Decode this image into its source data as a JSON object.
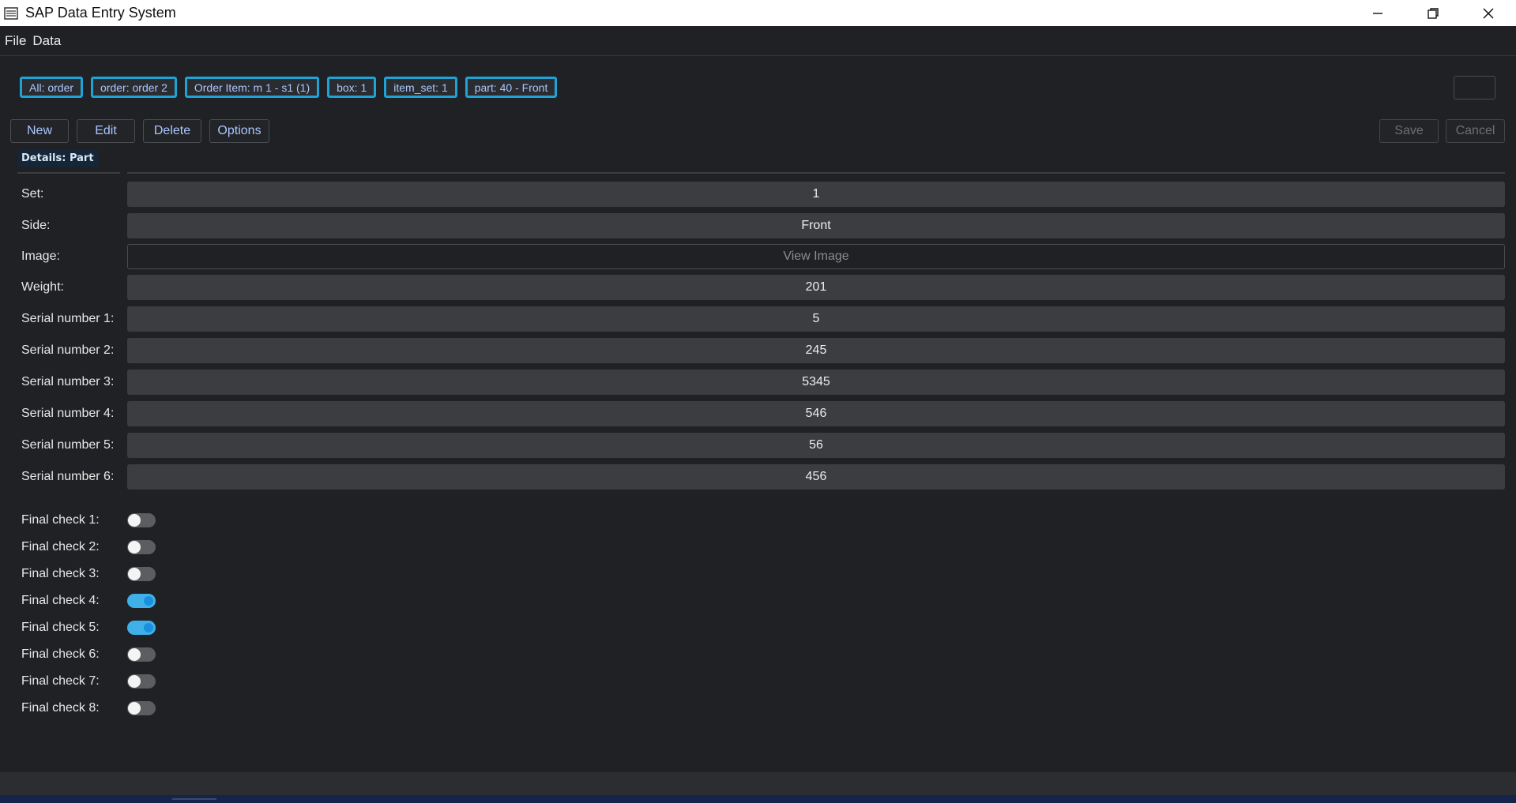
{
  "window": {
    "title": "SAP Data Entry System"
  },
  "menu": [
    "File",
    "Data"
  ],
  "breadcrumbs": [
    "All: order",
    "order: order 2",
    "Order Item: m 1 - s1 (1)",
    "box: 1",
    "item_set: 1",
    "part: 40 - Front"
  ],
  "toolbar": {
    "new_label": "New",
    "edit_label": "Edit",
    "delete_label": "Delete",
    "options_label": "Options",
    "save_label": "Save",
    "cancel_label": "Cancel"
  },
  "details": {
    "header": "Details: Part"
  },
  "fields": [
    {
      "label": "Set:",
      "value": "1"
    },
    {
      "label": "Side:",
      "value": "Front"
    },
    {
      "label": "Image:",
      "value": "View Image"
    },
    {
      "label": "Weight:",
      "value": "201"
    },
    {
      "label": "Serial number 1:",
      "value": "5"
    },
    {
      "label": "Serial number 2:",
      "value": "245"
    },
    {
      "label": "Serial number 3:",
      "value": "5345"
    },
    {
      "label": "Serial number 4:",
      "value": "546"
    },
    {
      "label": "Serial number 5:",
      "value": "56"
    },
    {
      "label": "Serial number 6:",
      "value": "456"
    }
  ],
  "checks": [
    {
      "label": "Final check 1:",
      "on": false
    },
    {
      "label": "Final check 2:",
      "on": false
    },
    {
      "label": "Final check 3:",
      "on": false
    },
    {
      "label": "Final check 4:",
      "on": true
    },
    {
      "label": "Final check 5:",
      "on": true
    },
    {
      "label": "Final check 6:",
      "on": false
    },
    {
      "label": "Final check 7:",
      "on": false
    },
    {
      "label": "Final check 8:",
      "on": false
    }
  ],
  "colors": {
    "accent": "#1fa3d4",
    "toggle_on": "#3fb1e8",
    "background": "#202124"
  }
}
